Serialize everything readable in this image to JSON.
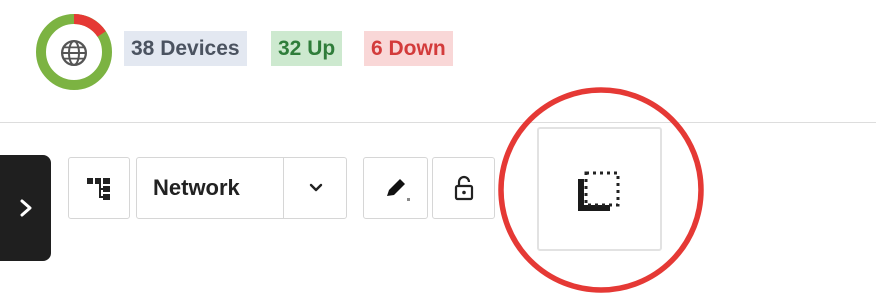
{
  "status": {
    "total": 38,
    "up": 32,
    "down": 6,
    "devices_label": "38 Devices",
    "up_label": "32 Up",
    "down_label": "6 Down"
  },
  "colors": {
    "up": "#7cb342",
    "down": "#e53935",
    "devices_badge_bg": "#e3e8f1",
    "up_badge_bg": "#cde9cf",
    "down_badge_bg": "#f9d7d7",
    "highlight": "#e53935"
  },
  "icons": {
    "status": "globe-icon",
    "sidebar_toggle": "chevron-right-icon",
    "tree": "tree-layout-icon",
    "dropdown": "chevron-down-icon",
    "edit": "pencil-icon",
    "lock": "lock-open-icon",
    "select_area": "select-area-icon"
  },
  "toolbar": {
    "network_label": "Network"
  }
}
